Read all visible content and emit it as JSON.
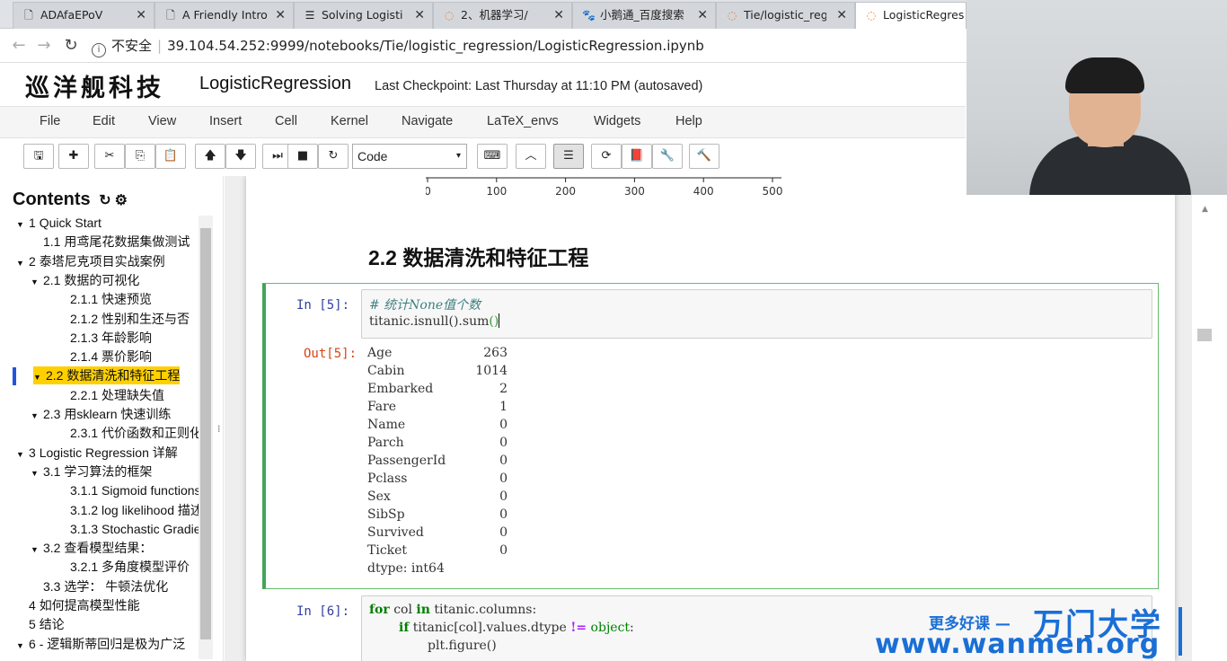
{
  "browser": {
    "tabs": [
      {
        "label": "ADAfaEPoV",
        "icon": "document-icon",
        "active": false
      },
      {
        "label": "A Friendly Intro",
        "icon": "document-icon",
        "active": false
      },
      {
        "label": "Solving Logisti",
        "icon": "list-icon",
        "active": false
      },
      {
        "label": "2、机器学习/",
        "icon": "jupyter-icon",
        "active": false
      },
      {
        "label": "小鹅通_百度搜索",
        "icon": "baidu-icon",
        "active": false
      },
      {
        "label": "Tie/logistic_reg",
        "icon": "jupyter-icon",
        "active": false
      },
      {
        "label": "LogisticRegres",
        "icon": "jupyter-icon",
        "active": true
      }
    ],
    "close_glyph": "✕",
    "security_label": "不安全",
    "url": "39.104.54.252:9999/notebooks/Tie/logistic_regression/LogisticRegression.ipynb"
  },
  "header": {
    "logo_text": "巡洋舰科技",
    "notebook_name": "LogisticRegression",
    "checkpoint": "Last Checkpoint: Last Thursday at 11:10 PM (autosaved)"
  },
  "menu": [
    "File",
    "Edit",
    "View",
    "Insert",
    "Cell",
    "Kernel",
    "Navigate",
    "LaTeX_envs",
    "Widgets",
    "Help"
  ],
  "toolbar": {
    "cell_type": "Code",
    "caret": "▾",
    "buttons": [
      {
        "name": "save-icon",
        "glyph": "🖫"
      },
      {
        "name": "plus-icon",
        "glyph": "✚"
      },
      {
        "name": "cut-icon",
        "glyph": "✂"
      },
      {
        "name": "copy-icon",
        "glyph": "⎘"
      },
      {
        "name": "paste-icon",
        "glyph": "📋"
      },
      {
        "name": "arrow-up-icon",
        "glyph": "🡅"
      },
      {
        "name": "arrow-down-icon",
        "glyph": "🡇"
      },
      {
        "name": "step-forward-icon",
        "glyph": "⏭"
      },
      {
        "name": "stop-icon",
        "glyph": "■"
      },
      {
        "name": "refresh-icon",
        "glyph": "↻"
      },
      {
        "name": "keyboard-icon",
        "glyph": "⌨"
      },
      {
        "name": "chevron-up-icon",
        "glyph": "︿"
      },
      {
        "name": "toc-list-icon",
        "glyph": "☰"
      },
      {
        "name": "reload-icon",
        "glyph": "⟳"
      },
      {
        "name": "book-icon",
        "glyph": "📕"
      },
      {
        "name": "wrench-icon",
        "glyph": "🔧"
      },
      {
        "name": "hammer-icon",
        "glyph": "🔨"
      }
    ]
  },
  "toc": {
    "title": "Contents",
    "title_icons": [
      "↻",
      "⚙"
    ],
    "items": [
      {
        "num": "1",
        "label": "Quick Start",
        "caret": "▼",
        "level": 0
      },
      {
        "num": "1.1",
        "label": "用鸢尾花数据集做测试",
        "caret": "",
        "level": 1
      },
      {
        "num": "2",
        "label": "泰塔尼克项目实战案例",
        "caret": "▼",
        "level": 0
      },
      {
        "num": "2.1",
        "label": "数据的可视化",
        "caret": "▼",
        "level": 1
      },
      {
        "num": "2.1.1",
        "label": "快速预览",
        "caret": "",
        "level": 2
      },
      {
        "num": "2.1.2",
        "label": "性别和生还与否",
        "caret": "",
        "level": 2
      },
      {
        "num": "2.1.3",
        "label": "年龄影响",
        "caret": "",
        "level": 2
      },
      {
        "num": "2.1.4",
        "label": "票价影响",
        "caret": "",
        "level": 2
      },
      {
        "num": "2.2",
        "label": "数据清洗和特征工程",
        "caret": "▼",
        "level": 1,
        "highlight": true
      },
      {
        "num": "2.2.1",
        "label": "处理缺失值",
        "caret": "",
        "level": 2
      },
      {
        "num": "2.3",
        "label": "用sklearn 快速训练",
        "caret": "▼",
        "level": 1
      },
      {
        "num": "2.3.1",
        "label": "代价函数和正则化",
        "caret": "",
        "level": 2
      },
      {
        "num": "3",
        "label": "Logistic Regression 详解",
        "caret": "▼",
        "level": 0
      },
      {
        "num": "3.1",
        "label": "学习算法的框架",
        "caret": "▼",
        "level": 1
      },
      {
        "num": "3.1.1",
        "label": "Sigmoid functions",
        "caret": "",
        "level": 2
      },
      {
        "num": "3.1.2",
        "label": "log likelihood 描述",
        "caret": "",
        "level": 2
      },
      {
        "num": "3.1.3",
        "label": "Stochastic Gradient",
        "caret": "",
        "level": 2
      },
      {
        "num": "3.2",
        "label": "查看模型结果：",
        "caret": "▼",
        "level": 1
      },
      {
        "num": "3.2.1",
        "label": "多角度模型评价",
        "caret": "",
        "level": 2
      },
      {
        "num": "3.3",
        "label": "选学： 牛顿法优化",
        "caret": "",
        "level": 1
      },
      {
        "num": "4",
        "label": "如何提高模型性能",
        "caret": "",
        "level": 0
      },
      {
        "num": "5",
        "label": "结论",
        "caret": "",
        "level": 0
      },
      {
        "num": "6",
        "label": "- 逻辑斯蒂回归是极为广泛",
        "caret": "▼",
        "level": 0
      }
    ]
  },
  "notebook": {
    "axis_ticks": [
      "0",
      "100",
      "200",
      "300",
      "400",
      "500"
    ],
    "section_heading": "2.2  数据清洗和特征工程",
    "cell5": {
      "in_prompt": "In  [5]:",
      "out_prompt": "Out[5]:",
      "comment": "# 统计None值个数",
      "code_pre": "titanic.isnull().sum",
      "code_parens": "()",
      "output": [
        [
          "Age",
          "263"
        ],
        [
          "Cabin",
          "1014"
        ],
        [
          "Embarked",
          "2"
        ],
        [
          "Fare",
          "1"
        ],
        [
          "Name",
          "0"
        ],
        [
          "Parch",
          "0"
        ],
        [
          "PassengerId",
          "0"
        ],
        [
          "Pclass",
          "0"
        ],
        [
          "Sex",
          "0"
        ],
        [
          "SibSp",
          "0"
        ],
        [
          "Survived",
          "0"
        ],
        [
          "Ticket",
          "0"
        ]
      ],
      "dtype": "dtype: int64"
    },
    "cell6": {
      "in_prompt": "In  [6]:",
      "line1": {
        "kw1": "for",
        "mid": " col ",
        "kw2": "in",
        "rest": " titanic.columns:"
      },
      "line2": {
        "kw": "if",
        "mid": " titanic[col].values.dtype ",
        "op": "!=",
        "sp": " ",
        "bi": "object",
        "colon": ":"
      },
      "line3": "plt.figure()"
    }
  },
  "watermark": {
    "line1": "更多好课 —",
    "brand": "万门大学",
    "url": "www.wanmen.org"
  },
  "colors": {
    "prompt_in": "#303f9f",
    "prompt_out": "#d84315",
    "selected_cell": "#42a55a",
    "toc_highlight": "#ffd000",
    "watermark": "#1a6fd6"
  }
}
